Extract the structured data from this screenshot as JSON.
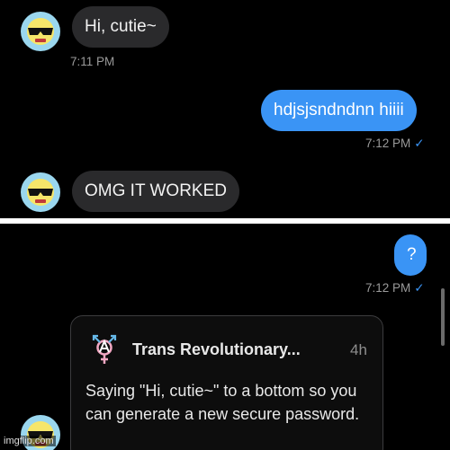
{
  "messages": {
    "m1": {
      "text": "Hi, cutie~",
      "time": "7:11 PM"
    },
    "m2": {
      "text": "hdjsjsndndnn hiiii",
      "time": "7:12 PM",
      "check": "✓"
    },
    "m3": {
      "text": "OMG IT WORKED"
    },
    "m4": {
      "text": "?",
      "time": "7:12 PM",
      "check": "✓"
    }
  },
  "shared_post": {
    "author": "Trans Revolutionary...",
    "age": "4h",
    "text": "Saying \"Hi, cutie~\" to a bottom so you can generate a new secure password."
  },
  "watermark": "imgflip.com",
  "colors": {
    "outgoing_bubble": "#3a94f5",
    "incoming_bubble": "#2a2a2c",
    "background": "#000000"
  },
  "icons": {
    "avatar": "cool-sunglasses-face-icon",
    "post_logo": "trans-anarchy-symbol-icon"
  }
}
